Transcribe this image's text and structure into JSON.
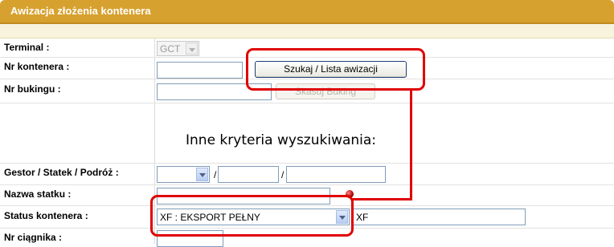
{
  "window": {
    "title": "Awizacja złożenia kontenera"
  },
  "form": {
    "terminal": {
      "label": "Terminal :",
      "value": "GCT"
    },
    "container_no": {
      "label": "Nr kontenera :",
      "value": ""
    },
    "booking_no": {
      "label": "Nr bukingu :",
      "value": ""
    },
    "search_button": "Szukaj / Lista awizacji",
    "delete_booking_button": "Skasuj Buking",
    "other_criteria_heading": "Inne kryteria wyszukiwania:",
    "gestor_ship_voyage": {
      "label": "Gestor / Statek / Podróż :",
      "gestor": "",
      "ship": "",
      "voyage": "",
      "separator": "/"
    },
    "ship_name": {
      "label": "Nazwa statku :",
      "value": ""
    },
    "container_status": {
      "label": "Status kontenera :",
      "selected": "XF : EKSPORT PEŁNY",
      "code": "XF"
    },
    "tractor_no": {
      "label": "Nr ciągnika :",
      "value": ""
    }
  },
  "colors": {
    "header": "#d7a12f",
    "highlight": "#e00000"
  }
}
